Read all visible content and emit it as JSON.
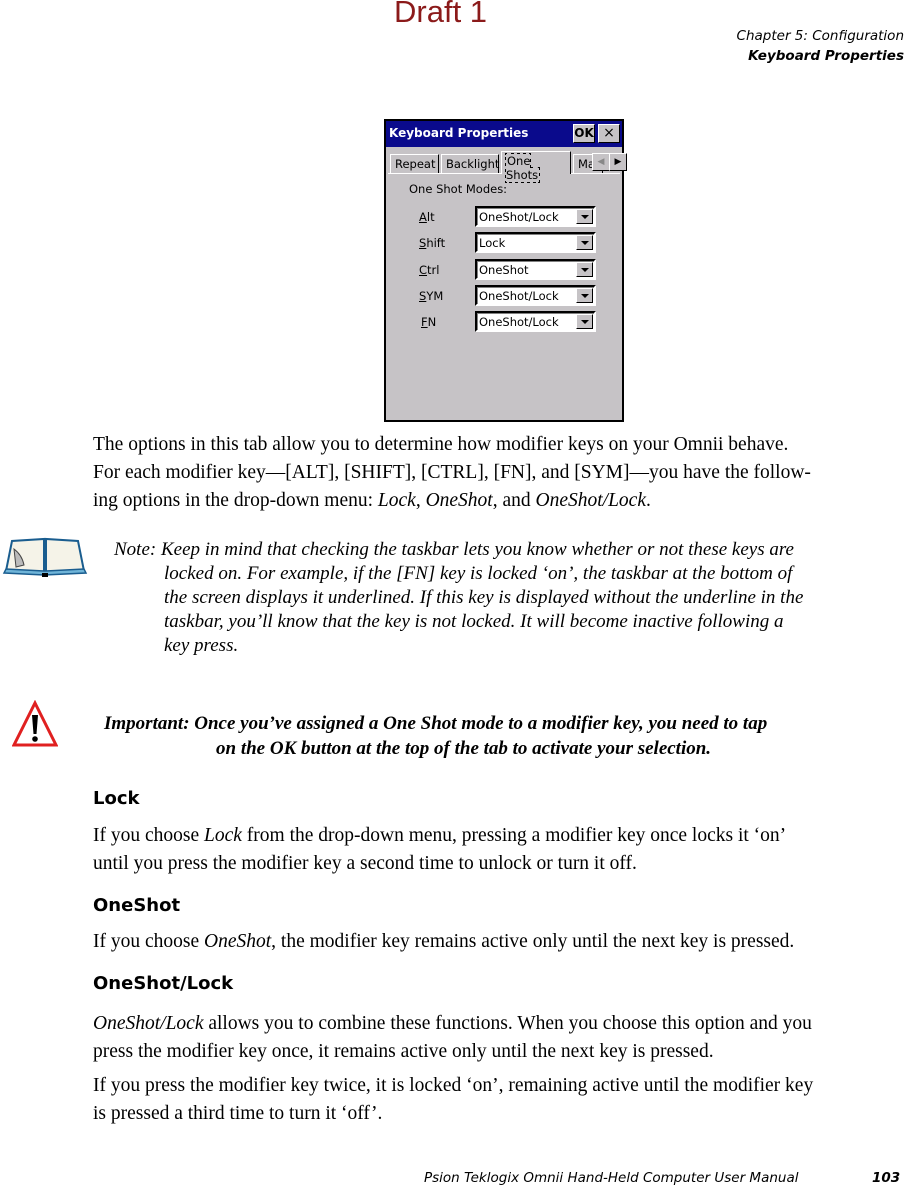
{
  "watermark": "Draft 1",
  "header": {
    "chapter": "Chapter 5:  Configuration",
    "section": "Keyboard Properties"
  },
  "dialog": {
    "title": "Keyboard Properties",
    "ok_label": "OK",
    "close_label": "×",
    "tabs": [
      {
        "label": "Repeat",
        "active": false
      },
      {
        "label": "Backlight",
        "active": false
      },
      {
        "label": "One Shots",
        "active": true
      },
      {
        "label": "Ma",
        "active": false
      }
    ],
    "scroll_left": "◀",
    "scroll_right": "▶",
    "group_label": "One Shot Modes:",
    "rows": [
      {
        "label_u": "A",
        "label_rest": "lt",
        "value": "OneShot/Lock"
      },
      {
        "label_u": "S",
        "label_rest": "hift",
        "value": "Lock"
      },
      {
        "label_u": "C",
        "label_rest": "trl",
        "value": "OneShot"
      },
      {
        "label_u": "S",
        "label_rest": "YM",
        "value": "OneShot/Lock"
      },
      {
        "label_u": "F",
        "label_rest": "N",
        "value": "OneShot/Lock"
      }
    ]
  },
  "intro": {
    "line1": "The options in this tab allow you to determine how modifier keys on your Omnii behave.",
    "line2": "For each modifier key—[ALT], [SHIFT], [CTRL], [FN], and [SYM]—you have the follow-",
    "line3_pre": "ing options in the drop-down menu: ",
    "opt1": "Lock",
    "sep1": ", ",
    "opt2": "OneShot",
    "sep2": ", and ",
    "opt3": "OneShot/Lock",
    "end": "."
  },
  "note": {
    "line1": "Note: Keep in mind that checking the taskbar lets you know whether or not these keys are",
    "line2": "locked on. For example, if the [FN] key is locked ‘on’, the taskbar at the bottom of",
    "line3": "the screen displays it underlined. If this key is displayed without the underline in the",
    "line4": "taskbar, you’ll know that the key is not locked. It will become inactive following a",
    "line5": "key press."
  },
  "important": {
    "line1": "Important:  Once you’ve assigned a One Shot mode to a modifier key, you need to tap",
    "line2": "on the OK button at the top of the tab to activate your selection."
  },
  "sections": {
    "lock": {
      "heading": "Lock",
      "pre": "If you choose ",
      "em": "Lock",
      "post": " from the drop-down menu, pressing a modifier key once locks it ‘on’",
      "line2": "until you press the modifier key a second time to unlock or turn it off."
    },
    "oneshot": {
      "heading": "OneShot",
      "pre": "If you choose ",
      "em": "OneShot",
      "post": ", the modifier key remains active only until the next key is pressed."
    },
    "oneshotlock": {
      "heading": "OneShot/Lock",
      "em": "OneShot/Lock",
      "post": " allows you to combine these functions. When you choose this option and you",
      "line2": "press the modifier key once, it remains active only until the next key is pressed.",
      "p2_line1": "If you press the modifier key twice, it is locked ‘on’, remaining active until the modifier key",
      "p2_line2": "is pressed a third time to turn it ‘off’."
    }
  },
  "footer": {
    "title": "Psion Teklogix Omnii Hand-Held Computer User Manual",
    "page": "103"
  }
}
